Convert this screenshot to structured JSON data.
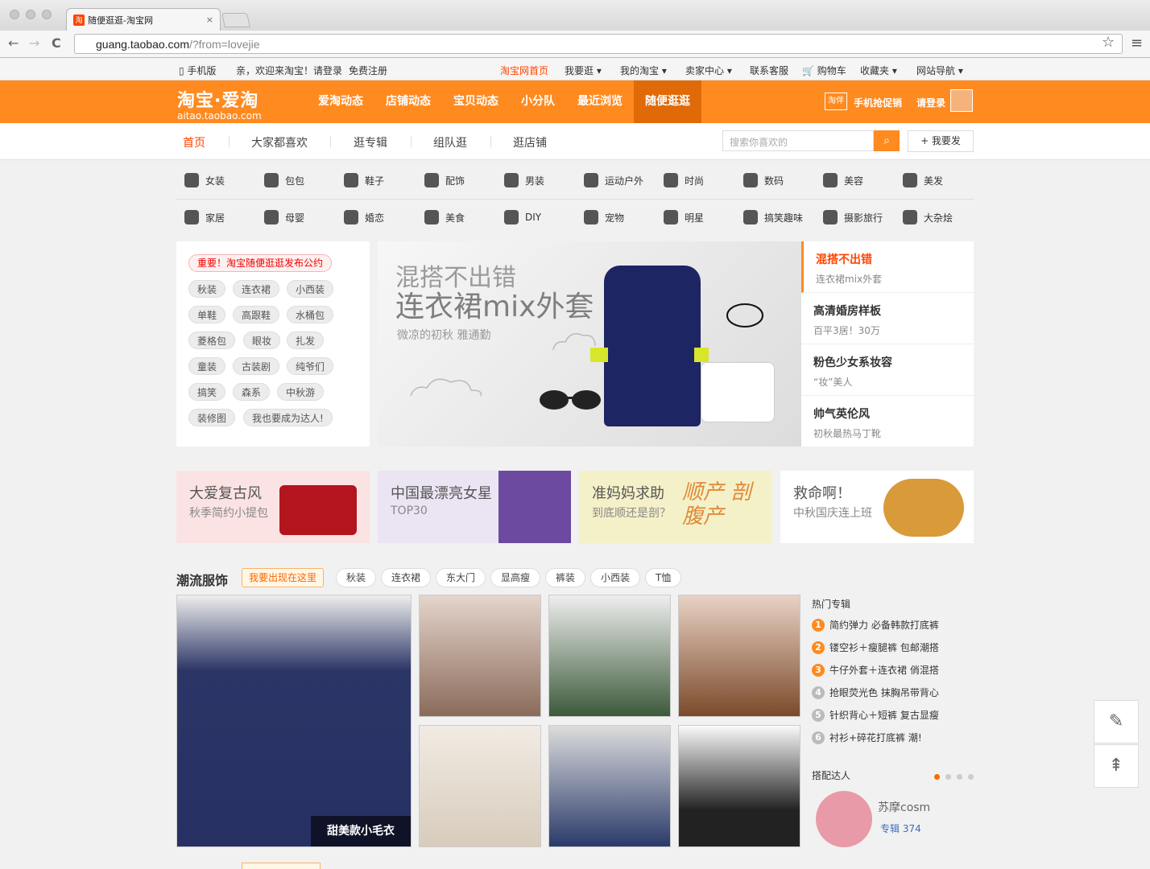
{
  "browser": {
    "tab_title": "随便逛逛-淘宝网",
    "tab_favicon": "淘",
    "tab_close": "×",
    "url_host": "guang.taobao.com",
    "url_path": "/?from=lovejie",
    "back": "←",
    "forward": "→",
    "reload": "C",
    "star": "☆",
    "menu": "≡"
  },
  "site_nav": {
    "mobile": "手机版",
    "welcome": "亲，欢迎来淘宝！",
    "login": "请登录",
    "register": "免费注册",
    "home": "淘宝网首页",
    "buy": "我要逛 ▾",
    "my_taobao": "我的淘宝 ▾",
    "seller": "卖家中心 ▾",
    "service": "联系客服",
    "cart": "购物车",
    "favorites": "收藏夹 ▾",
    "sitemap": "网站导航 ▾"
  },
  "header": {
    "logo_main": "淘宝·爱淘",
    "logo_sub": "aitao.taobao.com",
    "tabs": [
      "爱淘动态",
      "店铺动态",
      "宝贝动态",
      "小分队",
      "最近浏览",
      "随便逛逛"
    ],
    "mobile_promo": "手机抢促销",
    "login": "请登录",
    "mobile_badge": "淘伴"
  },
  "subnav": {
    "tabs": [
      "首页",
      "大家都喜欢",
      "逛专辑",
      "组队逛",
      "逛店铺"
    ],
    "search_placeholder": "搜索你喜欢的",
    "search_btn": "⌕",
    "post": "+ 我要发"
  },
  "categories": {
    "row1": [
      "女装",
      "包包",
      "鞋子",
      "配饰",
      "男装",
      "运动户外",
      "时尚",
      "数码",
      "美容",
      "美发"
    ],
    "row2": [
      "家居",
      "母婴",
      "婚恋",
      "美食",
      "DIY",
      "宠物",
      "明星",
      "搞笑趣味",
      "摄影旅行",
      "大杂烩"
    ]
  },
  "tags": {
    "notice": "重要！淘宝随便逛逛发布公约",
    "items": [
      "秋装",
      "连衣裙",
      "小西装",
      "单鞋",
      "高跟鞋",
      "水桶包",
      "菱格包",
      "眼妆",
      "扎发",
      "童装",
      "古装剧",
      "纯爷们",
      "搞笑",
      "森系",
      "中秋游",
      "装修图",
      "我也要成为达人!"
    ]
  },
  "banner": {
    "line1": "混搭不出错",
    "line2": "连衣裙mix外套",
    "line3": "微凉的初秋 雅通勤"
  },
  "feed": [
    {
      "title": "混搭不出错",
      "sub": "连衣裙mix外套"
    },
    {
      "title": "高清婚房样板",
      "sub": "百平3居！30万"
    },
    {
      "title": "粉色少女系妆容",
      "sub": "“妆”美人"
    },
    {
      "title": "帅气英伦风",
      "sub": "初秋最热马丁靴"
    }
  ],
  "promos": [
    {
      "title": "大爱复古风",
      "sub": "秋季简约小提包",
      "color": "#fbe3e3"
    },
    {
      "title": "中国最漂亮女星",
      "sub": "TOP30",
      "color": "#ebe4f3"
    },
    {
      "title": "准妈妈求助",
      "sub": "到底顺还是剖？",
      "color": "#f4f1c8"
    },
    {
      "title": "救命啊！",
      "sub": "中秋国庆连上班",
      "color": "#fff"
    }
  ],
  "promo_art": {
    "p3": "顺产 剖腹产"
  },
  "fashion": {
    "title": "潮流服饰",
    "me_btn": "我要出现在这里",
    "tags": [
      "秋装",
      "连衣裙",
      "东大门",
      "显高瘦",
      "裤装",
      "小西装",
      "T恤"
    ],
    "big_caption": "甜美款小毛衣",
    "hot_title": "热门专辑",
    "hot": [
      "简约弹力   必备韩款打底裤",
      "镂空衫＋瘦腿裤   包邮潮搭",
      "牛仔外套＋连衣裙   俏混搭",
      "抢眼荧光色 抹胸吊带背心",
      "针织背心＋短裤 复古显瘦",
      "衬衫+碎花打底裤 潮!"
    ],
    "daren_title": "搭配达人",
    "daren_name": "苏摩cosm",
    "daren_label": "专辑 374"
  },
  "side": {
    "edit": "✎",
    "top": "⇞"
  }
}
